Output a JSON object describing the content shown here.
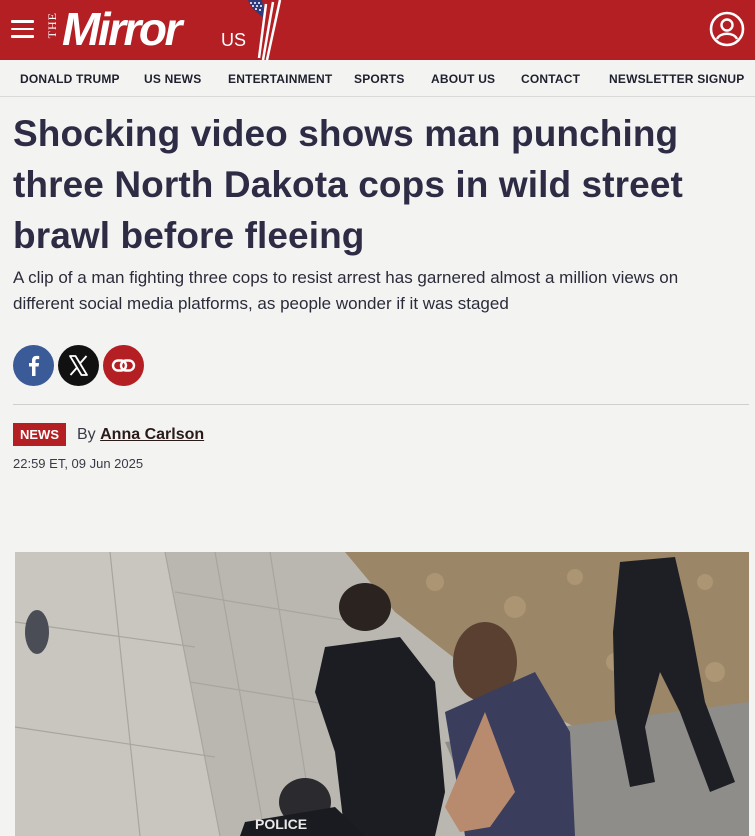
{
  "header": {
    "logo": {
      "the": "THE",
      "brand": "Mirror",
      "edition": "US"
    },
    "menu_icon": "hamburger-menu-icon",
    "account_icon": "user-account-icon",
    "brand_color": "#b41f23"
  },
  "nav": {
    "items": [
      "DONALD TRUMP",
      "US NEWS",
      "ENTERTAINMENT",
      "SPORTS",
      "ABOUT US",
      "CONTACT",
      "NEWSLETTER SIGNUP"
    ]
  },
  "article": {
    "headline": "Shocking video shows man punching three North Dakota cops in wild street brawl before fleeing",
    "standfirst": "A clip of a man fighting three cops to resist arrest has garnered almost a million views on different social media platforms, as people wonder if it was staged",
    "share": [
      {
        "icon": "facebook-icon",
        "color": "#3b5a98"
      },
      {
        "icon": "x-icon",
        "color": "#111111"
      },
      {
        "icon": "link-icon",
        "color": "#b41f23"
      }
    ],
    "category": "NEWS",
    "by_prefix": "By",
    "author": "Anna Carlson",
    "timestamp": "22:59 ET, 09 Jun 2025",
    "hero_image": {
      "icon": "article-hero-photo",
      "overlay_text": "POLICE"
    }
  }
}
